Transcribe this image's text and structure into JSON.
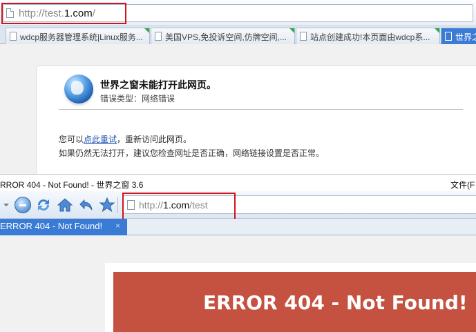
{
  "top_browser": {
    "url_prefix": "http://test.",
    "url_domain": "1.com",
    "url_suffix": "/",
    "tabs": [
      {
        "label": "wdcp服务器管理系统|Linux服务..."
      },
      {
        "label": "美国VPS,免投诉空间,仿牌空间,..."
      },
      {
        "label": "站点创建成功!本页面由wdcp系..."
      },
      {
        "label": "世界之"
      }
    ],
    "error": {
      "title": "世界之窗未能打开此网页。",
      "type_label": "错误类型：网络错误",
      "line1_before": "您可以",
      "line1_link": "点此重试",
      "line1_after": "，重新访问此网页。",
      "line2": "如果仍然无法打开，建议您检查网址是否正确，网络链接设置是否正常。"
    }
  },
  "bottom_browser": {
    "window_title": "RROR 404 - Not Found! - 世界之窗 3.6",
    "menu_file": "文件(F",
    "url_prefix": "http://",
    "url_domain": "1.com",
    "url_suffix": "/test",
    "tab_label": "ERROR 404 - Not Found!",
    "tab_close": "×",
    "page_heading": "ERROR 404 - Not Found!"
  },
  "colors": {
    "highlight_box": "#d3121b",
    "error_banner": "#c55140",
    "active_tab": "#3a7bd5"
  },
  "icons": [
    "page-icon",
    "globe-icon",
    "stop-icon",
    "refresh-icon",
    "home-icon",
    "back-icon",
    "favorite-star-icon",
    "close-icon",
    "dropdown-arrow-icon"
  ]
}
